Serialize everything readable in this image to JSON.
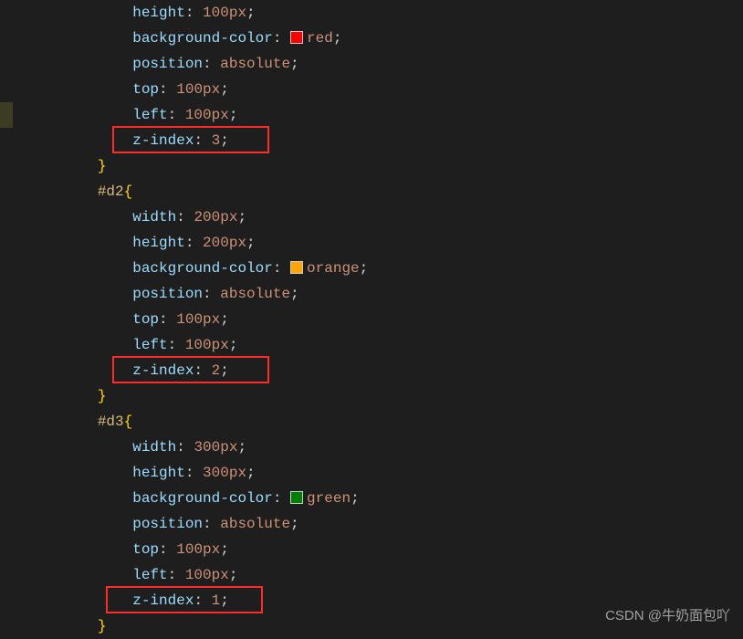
{
  "watermark": "CSDN @牛奶面包吖",
  "colors": {
    "red": "#ff0000",
    "orange": "#ffa500",
    "green": "#008000"
  },
  "code": {
    "d1_partial": {
      "height": {
        "prop": "height",
        "val": "100px"
      },
      "bg": {
        "prop": "background-color",
        "val": "red"
      },
      "pos": {
        "prop": "position",
        "val": "absolute"
      },
      "top": {
        "prop": "top",
        "val": "100px"
      },
      "left": {
        "prop": "left",
        "val": "100px"
      },
      "zidx": {
        "prop": "z-index",
        "val": "3"
      }
    },
    "d2": {
      "selector": "#d2",
      "width": {
        "prop": "width",
        "val": "200px"
      },
      "height": {
        "prop": "height",
        "val": "200px"
      },
      "bg": {
        "prop": "background-color",
        "val": "orange"
      },
      "pos": {
        "prop": "position",
        "val": "absolute"
      },
      "top": {
        "prop": "top",
        "val": "100px"
      },
      "left": {
        "prop": "left",
        "val": "100px"
      },
      "zidx": {
        "prop": "z-index",
        "val": "2"
      }
    },
    "d3": {
      "selector": "#d3",
      "width": {
        "prop": "width",
        "val": "300px"
      },
      "height": {
        "prop": "height",
        "val": "300px"
      },
      "bg": {
        "prop": "background-color",
        "val": "green"
      },
      "pos": {
        "prop": "position",
        "val": "absolute"
      },
      "top": {
        "prop": "top",
        "val": "100px"
      },
      "left": {
        "prop": "left",
        "val": "100px"
      },
      "zidx": {
        "prop": "z-index",
        "val": "1"
      }
    }
  },
  "punct": {
    "colon_sp": ": ",
    "semi": ";",
    "open_brace": "{",
    "close_brace": "}"
  }
}
